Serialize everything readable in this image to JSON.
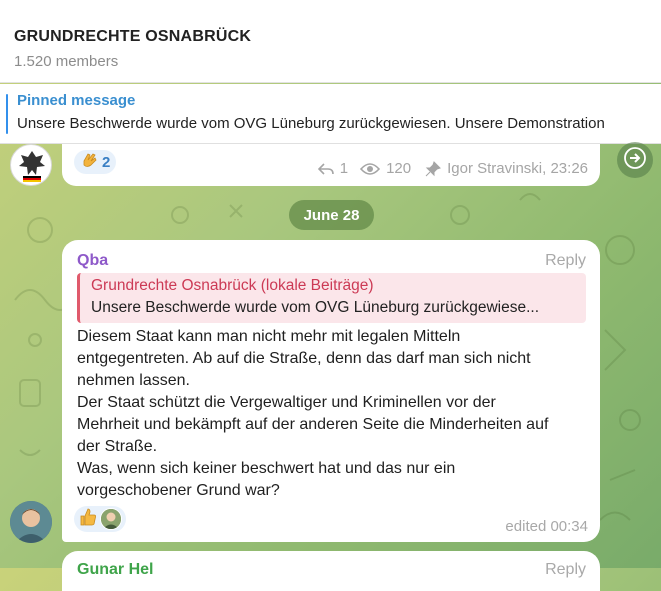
{
  "header": {
    "title": "GRUNDRECHTE OSNABRÜCK",
    "members": "1.520 members"
  },
  "pinned": {
    "title": "Pinned message",
    "text": "Unsere Beschwerde wurde vom OVG Lüneburg zurückgewiesen. Unsere Demonstration"
  },
  "message1": {
    "reaction_emoji": "clapping-hands",
    "reaction_count": "2",
    "replies": "1",
    "views": "120",
    "author_time": "Igor Stravinski, 23:26"
  },
  "date_separator": "June 28",
  "message2": {
    "sender": "Qba",
    "reply_label": "Reply",
    "quote_title": "Grundrechte Osnabrück (lokale Beiträge)",
    "quote_text": "Unsere Beschwerde wurde vom OVG Lüneburg zurückgewiese...",
    "body": [
      "Diesem Staat kann man nicht mehr mit legalen Mitteln",
      "entgegentreten. Ab auf die Straße, denn das darf man sich nicht",
      "nehmen lassen.",
      "Der Staat schützt die Vergewaltiger und Kriminellen vor der",
      "Mehrheit und bekämpft auf der anderen Seite die Minderheiten auf",
      "der Straße.",
      "Was, wenn sich keiner beschwert hat und das nur ein",
      "vorgeschobener Grund war?"
    ],
    "edited": "edited 00:34"
  },
  "message3": {
    "sender": "Gunar Hel",
    "reply_label": "Reply"
  },
  "colors": {
    "accent": "#3390ec",
    "sender_purple": "#8e59c9",
    "quote_red": "#cc3a55"
  }
}
